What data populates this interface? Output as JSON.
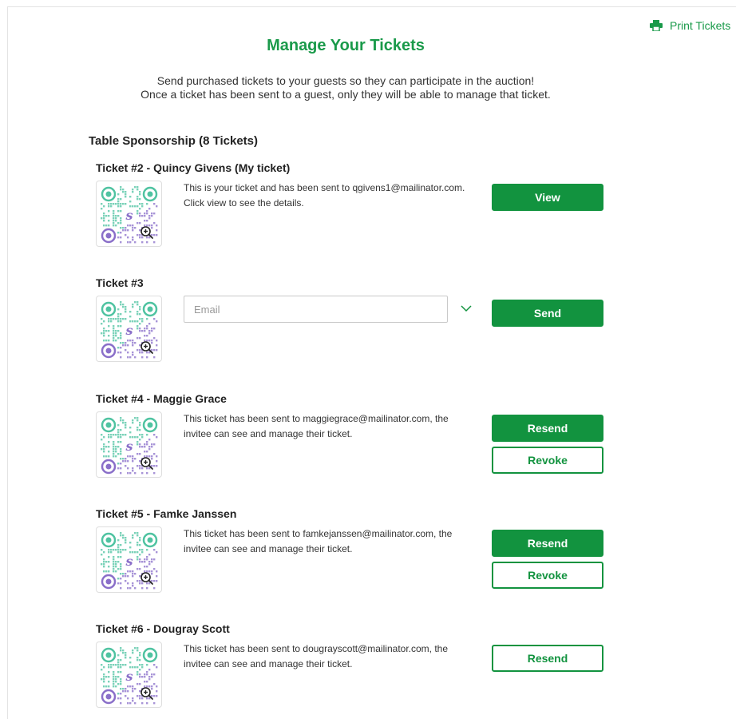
{
  "header": {
    "print_label": "Print Tickets",
    "title": "Manage Your Tickets",
    "intro_line1": "Send purchased tickets to your guests so they can participate in the auction!",
    "intro_line2": "Once a ticket has been sent to a guest, only they will be able to manage that ticket."
  },
  "group": {
    "title": "Table Sponsorship (8 Tickets)"
  },
  "tickets": [
    {
      "title": "Ticket #2 - Quincy Givens (My ticket)",
      "description": "This is your ticket and has been sent to qgivens1@mailinator.com. Click view to see the details.",
      "primary_label": "View"
    },
    {
      "title": "Ticket #3",
      "email_placeholder": "Email",
      "email_value": "",
      "primary_label": "Send"
    },
    {
      "title": "Ticket #4 - Maggie Grace",
      "description": "This ticket has been sent to maggiegrace@mailinator.com, the invitee can see and manage their ticket.",
      "primary_label": "Resend",
      "secondary_label": "Revoke"
    },
    {
      "title": "Ticket #5 - Famke Janssen",
      "description": "This ticket has been sent to famkejanssen@mailinator.com, the invitee can see and manage their ticket.",
      "primary_label": "Resend",
      "secondary_label": "Revoke"
    },
    {
      "title": "Ticket #6 - Dougray Scott",
      "description": "This ticket has been sent to dougrayscott@mailinator.com, the invitee can see and manage their ticket.",
      "primary_label": "Resend"
    }
  ],
  "icons": {
    "print": "printer-icon",
    "zoom": "zoom-in-icon",
    "chevron": "chevron-down-icon"
  },
  "colors": {
    "accent": "#12933f",
    "title_green": "#1a9a4a",
    "qr_teal": "#4fc3a1",
    "qr_purple": "#8a6fc9"
  }
}
